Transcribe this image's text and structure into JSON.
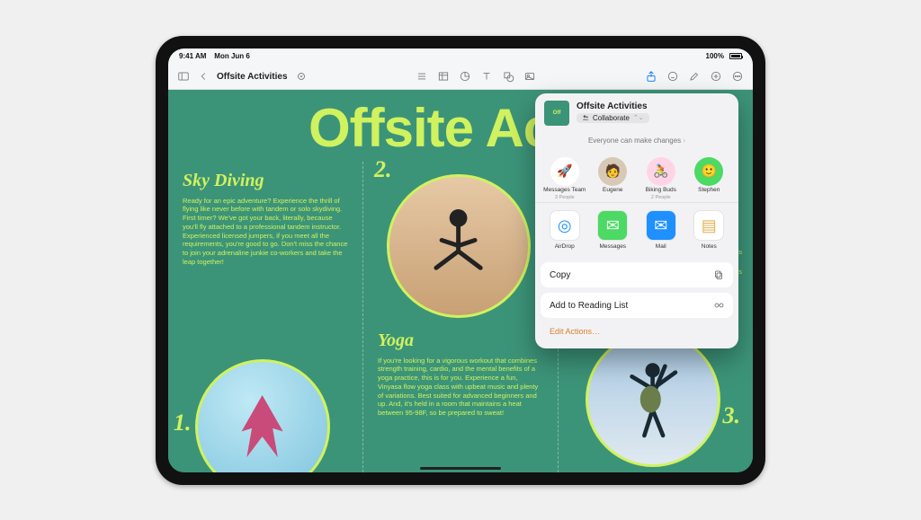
{
  "status": {
    "time": "9:41 AM",
    "date": "Mon Jun 6",
    "battery": "100%"
  },
  "toolbar": {
    "doc_title": "Offsite Activities"
  },
  "doc": {
    "headline": "Offsite Activ",
    "col1": {
      "subhead": "Sky Diving",
      "body": "Ready for an epic adventure? Experience the thrill of flying like never before with tandem or solo skydiving. First timer? We've got your back, literally, because you'll fly attached to a professional tandem instructor. Experienced licensed jumpers, if you meet all the requirements, you're good to go. Don't miss the chance to join your adrenaline junkie co-workers and take the leap together!",
      "num": "1."
    },
    "col2": {
      "num": "2.",
      "subhead": "Yoga",
      "body": "If you're looking for a vigorous workout that combines strength training, cardio, and the mental benefits of a yoga practice, this is for you. Experience a fun, Vinyasa flow yoga class with upbeat music and plenty of variations. Best suited for  advanced beginners and up. And, it's held in a room that maintains a heat between 95-98F, so be prepared to sweat!"
    },
    "col3": {
      "num": "3.",
      "frag1": "limbs",
      "frag2": "what's"
    }
  },
  "sheet": {
    "title": "Offsite Activities",
    "mode": "Collaborate",
    "perm": "Everyone can make changes",
    "contacts": [
      {
        "name": "Messages Team",
        "sub": "3 People",
        "bg": "#fff",
        "emoji": "🚀"
      },
      {
        "name": "Eugene",
        "sub": "",
        "bg": "#d7c9b6",
        "emoji": "🧑"
      },
      {
        "name": "Biking Buds",
        "sub": "2 People",
        "bg": "#ffd5e6",
        "emoji": "🚴"
      },
      {
        "name": "Stephen",
        "sub": "",
        "bg": "#4cd964",
        "emoji": "🙂"
      }
    ],
    "apps": [
      {
        "name": "AirDrop",
        "bg": "#fff",
        "glyph": "◎",
        "color": "#1e90ff"
      },
      {
        "name": "Messages",
        "bg": "#4cd964",
        "glyph": "✉",
        "color": "#fff"
      },
      {
        "name": "Mail",
        "bg": "#1e90ff",
        "glyph": "✉",
        "color": "#fff"
      },
      {
        "name": "Notes",
        "bg": "#fff",
        "glyph": "▤",
        "color": "#e0b050"
      }
    ],
    "copy": "Copy",
    "reading": "Add to Reading List",
    "edit": "Edit Actions…"
  }
}
